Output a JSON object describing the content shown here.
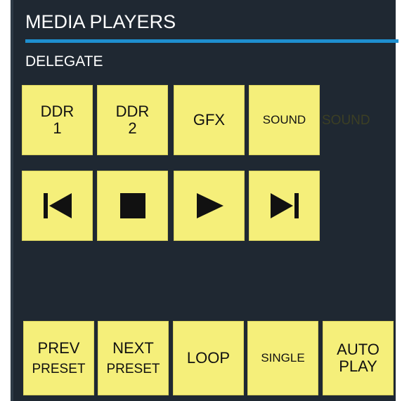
{
  "panel": {
    "title": "MEDIA PLAYERS",
    "section_label": "DELEGATE",
    "colors": {
      "background": "#1f2832",
      "accent": "#1e8fcf",
      "button": "#f5ef7a",
      "text_light": "#ffffff",
      "text_dark": "#111111"
    }
  },
  "delegate": {
    "ddr1": {
      "line1": "DDR",
      "line2": "1"
    },
    "ddr2": {
      "line1": "DDR",
      "line2": "2"
    },
    "gfx": {
      "label": "GFX"
    },
    "sound": {
      "label": "SOUND"
    },
    "ghost_sound": "SOUND"
  },
  "transport": {
    "prev_icon": "skip-to-start-icon",
    "stop_icon": "stop-icon",
    "play_icon": "play-icon",
    "next_icon": "skip-to-end-icon"
  },
  "bottom": {
    "prev_preset": {
      "line1": "PREV",
      "line2": "PRESET"
    },
    "next_preset": {
      "line1": "NEXT",
      "line2": "PRESET"
    },
    "loop": {
      "label": "LOOP"
    },
    "single": {
      "label": "SINGLE"
    },
    "auto_play": {
      "line1": "AUTO",
      "line2": "PLAY"
    }
  }
}
